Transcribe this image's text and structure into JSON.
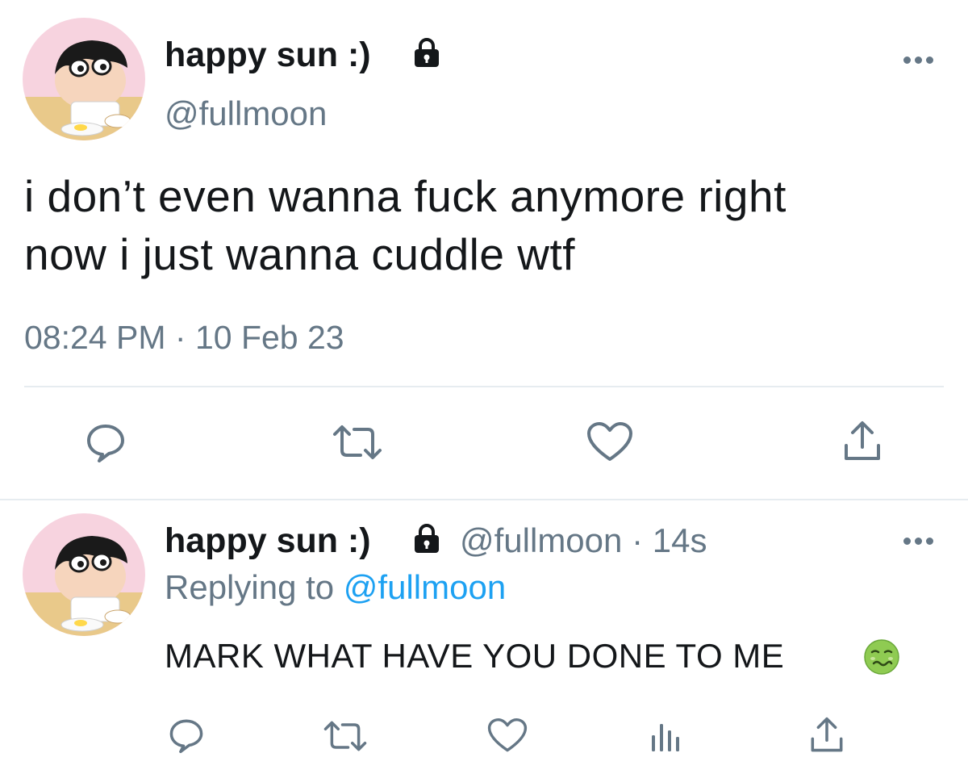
{
  "colors": {
    "text_primary": "#14171a",
    "text_secondary": "#657786",
    "link_blue": "#1da1f2",
    "divider": "#e6ecf0",
    "icon_gray": "#657786"
  },
  "main_tweet": {
    "display_name": "happy sun :)",
    "protected_icon": "lock-icon",
    "handle": "@fullmoon",
    "text_lines": [
      "i don’t even wanna fuck anymore right",
      "now i just wanna cuddle wtf"
    ],
    "time": "08:24 PM",
    "separator": "·",
    "date": "10 Feb 23",
    "actions": [
      "reply-icon",
      "retweet-icon",
      "like-icon",
      "share-icon"
    ]
  },
  "reply_tweet": {
    "display_name": "happy sun :)",
    "protected_icon": "lock-icon",
    "handle": "@fullmoon",
    "separator": "·",
    "age": "14s",
    "replying_prefix": "Replying to",
    "replying_to": "@fullmoon",
    "text": "MARK WHAT HAVE YOU DONE TO ME",
    "emoji": "nauseated-face-emoji",
    "actions": [
      "reply-icon",
      "retweet-icon",
      "like-icon",
      "analytics-icon",
      "share-icon"
    ]
  }
}
